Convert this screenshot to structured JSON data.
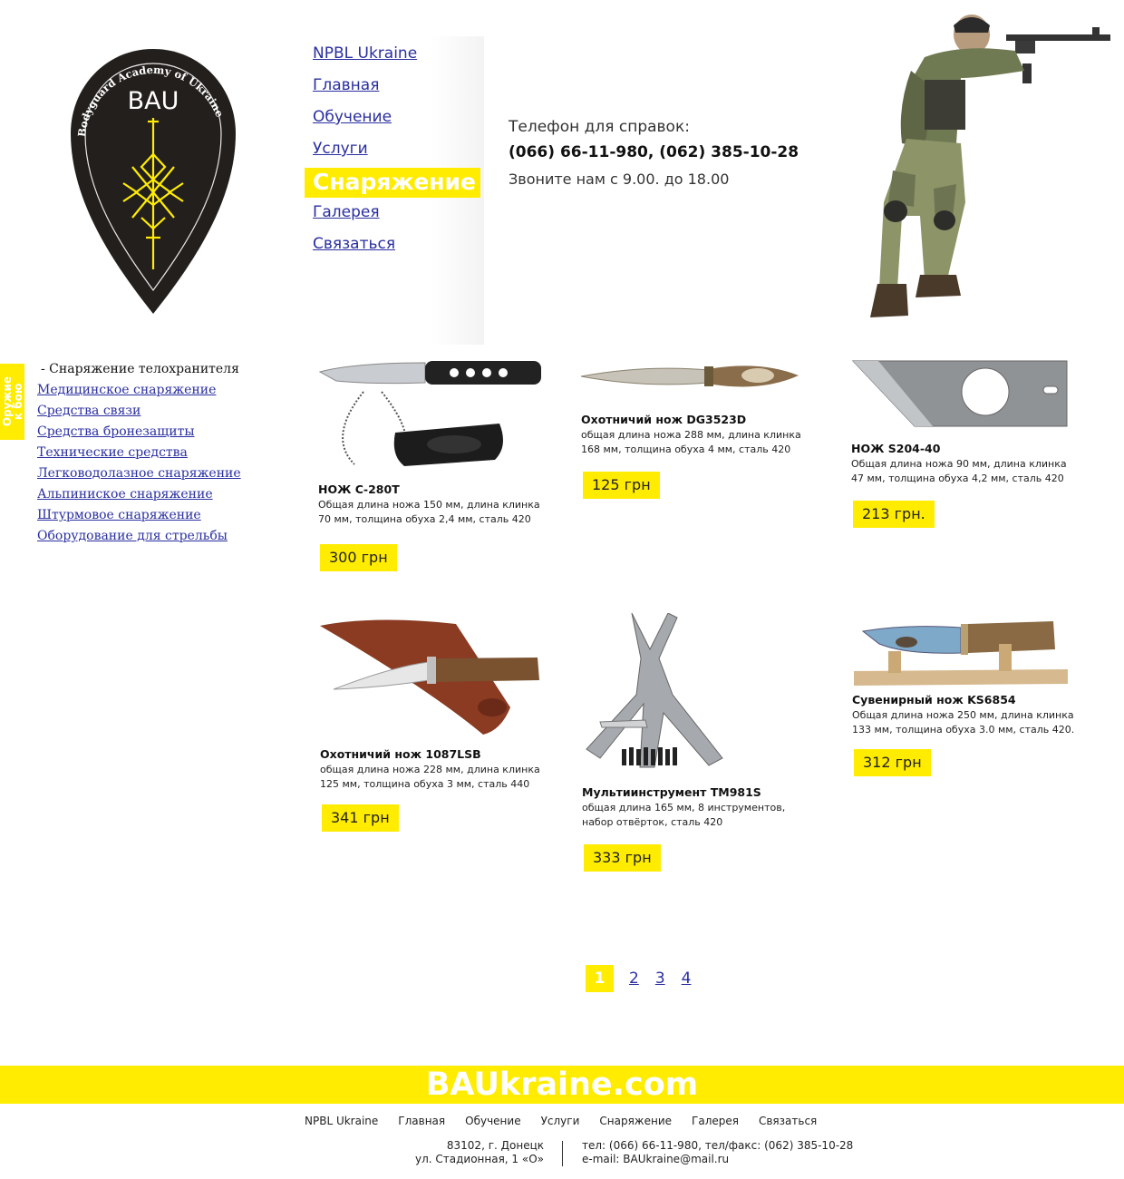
{
  "logo": {
    "text": "BAU",
    "ring_text": "Bodyguard Academy of Ukraine"
  },
  "nav": {
    "items": [
      "NPBL Ukraine",
      "Главная",
      "Обучение",
      "Услуги",
      "Снаряжение",
      "Галерея",
      "Связаться"
    ],
    "active": "Снаряжение"
  },
  "contact": {
    "label": "Телефон для справок:",
    "phones": "(066) 66-11-980, (062) 385-10-28",
    "hours": "Звоните нам с 9.00. до 18.00"
  },
  "side_tab": {
    "label": "Оружие\nк бою"
  },
  "categories": {
    "current": "- Снаряжение телохранителя",
    "links": [
      "Медицинское снаряжение",
      "Средства связи",
      "Средства бронезащиты",
      "Технические средства",
      "Легководолазное снаряжение",
      "Альпинискoе снаряжение",
      "Штурмовое снаряжение",
      "Оборудование для стрельбы"
    ]
  },
  "products": [
    {
      "name": "НОЖ С-280Т",
      "desc": "Общая длина ножа 150 мм, длина клинка 70 мм, толщина обуха 2,4 мм, сталь 420",
      "price": "300 грн",
      "image": "neck-knife-with-sheath"
    },
    {
      "name": "Охотничий нож DG3523D",
      "desc": "общая длина ножа 288 мм, длина клинка 168 мм, толщина обуха 4 мм, сталь 420",
      "price": "125 грн",
      "image": "dagger-knife"
    },
    {
      "name": "НОЖ S204-40",
      "desc": "Общая длина ножа 90 мм, длина клинка 47 мм, толщина обуха 4,2 мм, сталь 420",
      "price": "213 грн.",
      "image": "tanto-card-knife"
    },
    {
      "name": "Охотничий нож 1087LSB",
      "desc": "общая длина ножа 228 мм, длина клинка 125 мм, толщина обуха 3 мм, сталь 440",
      "price": "341 грн",
      "image": "hunting-knife-with-leather-sheath"
    },
    {
      "name": "Мультиинструмент ТМ981S",
      "desc": "общая длина 165 мм, 8 инструментов, набор отвёрток, сталь 420",
      "price": "333 грн",
      "image": "multitool"
    },
    {
      "name": "Сувенирный нож KS6854",
      "desc": "Общая длина ножа 250 мм, длина клинка 133 мм, толщина обуха 3.0 мм, сталь 420.",
      "price": "312 грн",
      "image": "souvenir-knife-on-stand"
    }
  ],
  "pagination": {
    "pages": [
      "1",
      "2",
      "3",
      "4"
    ],
    "current": "1"
  },
  "footer": {
    "site": "BAUkraine.com",
    "nav": [
      "NPBL Ukraine",
      "Главная",
      "Обучение",
      "Услуги",
      "Снаряжение",
      "Галерея",
      "Связаться"
    ],
    "address_line1": "83102, г. Донецк",
    "address_line2": "ул. Стадионная, 1 «О»",
    "tel_line": "тел: (066) 66-11-980, тел/факс: (062) 385-10-28",
    "email_line": "e-mail: BAUkraine@mail.ru"
  },
  "colors": {
    "accent": "#ffec00",
    "link": "#2a2fa0",
    "logo_dark": "#231f1c"
  }
}
